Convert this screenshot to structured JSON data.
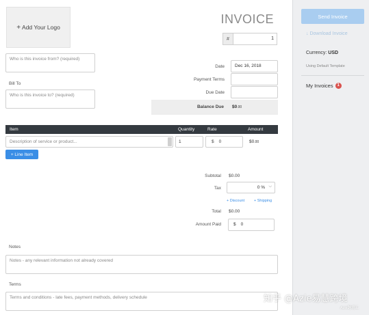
{
  "header": {
    "logo_plus": "+",
    "logo_label": "Add Your Logo",
    "title": "INVOICE",
    "number_prefix": "#",
    "number_value": "1"
  },
  "from": {
    "placeholder": "Who is this invoice from? (required)"
  },
  "bill_to": {
    "label": "Bill To",
    "placeholder": "Who is this invoice to? (required)"
  },
  "meta": {
    "date_label": "Date",
    "date_value": "Dec 16, 2018",
    "terms_label": "Payment Terms",
    "terms_value": "",
    "due_label": "Due Date",
    "due_value": "",
    "balance_label": "Balance Due",
    "balance_value": "$0",
    "balance_cents": ".00"
  },
  "items": {
    "headers": {
      "item": "Item",
      "quantity": "Quantity",
      "rate": "Rate",
      "amount": "Amount"
    },
    "row": {
      "description_placeholder": "Description of service or product...",
      "quantity": "1",
      "rate_currency": "$",
      "rate": "0",
      "amount": "$0",
      "amount_cents": ".00"
    },
    "add_button": "+ Line Item"
  },
  "totals": {
    "subtotal_label": "Subtotal",
    "subtotal_value": "$0.00",
    "tax_label": "Tax",
    "tax_value": "0 %",
    "discount_link": "+ Discount",
    "shipping_link": "+ Shipping",
    "total_label": "Total",
    "total_value": "$0.00",
    "paid_label": "Amount Paid",
    "paid_currency": "$",
    "paid_value": "0"
  },
  "notes": {
    "label": "Notes",
    "placeholder": "Notes - any relevant information not already covered"
  },
  "terms": {
    "label": "Terms",
    "placeholder": "Terms and conditions - late fees, payment methods, delivery schedule"
  },
  "sidebar": {
    "send_button": "Send Invoice",
    "download_link": "↓ Download Invoice",
    "currency_label": "Currency:",
    "currency_value": "USD",
    "template_note": "Using Default Template",
    "my_invoices": "My Invoices",
    "invoice_count": "1"
  },
  "watermark": {
    "text": "知乎 @Azie易慧跨境",
    "sub": "Azie跨境汇"
  },
  "colors": {
    "accent": "#3a8ee6",
    "header_bar": "#343a40",
    "badge": "#d9534f",
    "send_button": "#a9cdf0"
  }
}
